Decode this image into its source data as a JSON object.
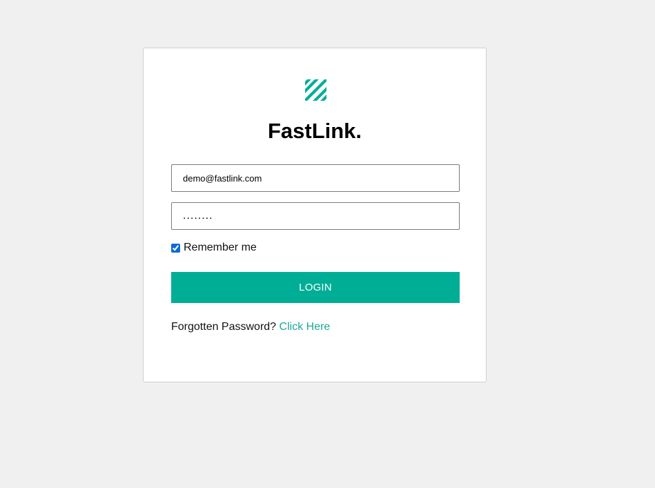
{
  "brand": {
    "name": "FastLink.",
    "logo_icon": "diagonal-stripes-logo-icon",
    "accent_color": "#00ae96"
  },
  "login_form": {
    "email_value": "demo@fastlink.com",
    "password_value": "........",
    "remember_label": "Remember me",
    "remember_checked": true,
    "login_label": "LOGIN",
    "forgot_text": "Forgotten Password?",
    "forgot_link_label": "Click Here"
  }
}
